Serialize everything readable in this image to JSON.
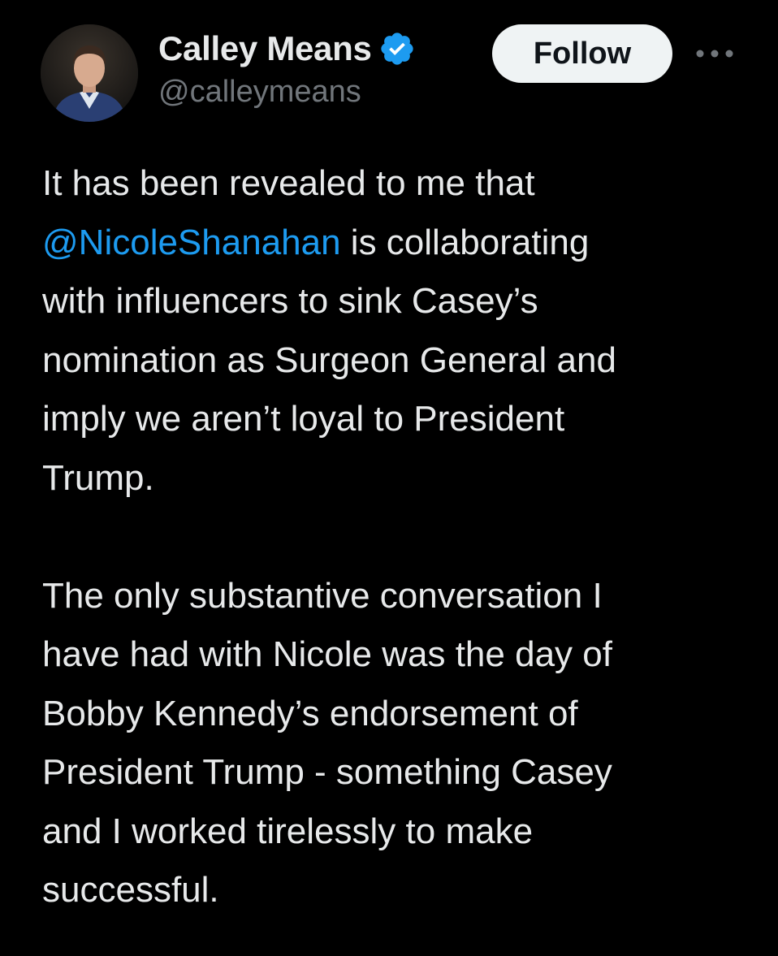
{
  "tweet": {
    "author": {
      "display_name": "Calley Means",
      "handle": "@calleymeans",
      "verified": true
    },
    "follow_label": "Follow",
    "more_icon": "more-horizontal-icon",
    "verified_icon": "verified-badge-icon",
    "body": {
      "p1_line1": "It has been revealed to me that",
      "p1_mention": "@NicoleShanahan",
      "p1_after_mention": " is collaborating",
      "p1_rest": "with influencers to sink Casey’s\nnomination as Surgeon General and\nimply we aren’t loyal to President\nTrump.",
      "p2": "The only substantive conversation I\nhave had with Nicole was the day of\nBobby Kennedy’s endorsement of\nPresident Trump - something Casey\nand I worked tirelessly to make\nsuccessful."
    }
  },
  "colors": {
    "background": "#000000",
    "text": "#e7e9ea",
    "secondary_text": "#71767b",
    "accent": "#1d9bf0",
    "follow_bg": "#eff3f4"
  }
}
